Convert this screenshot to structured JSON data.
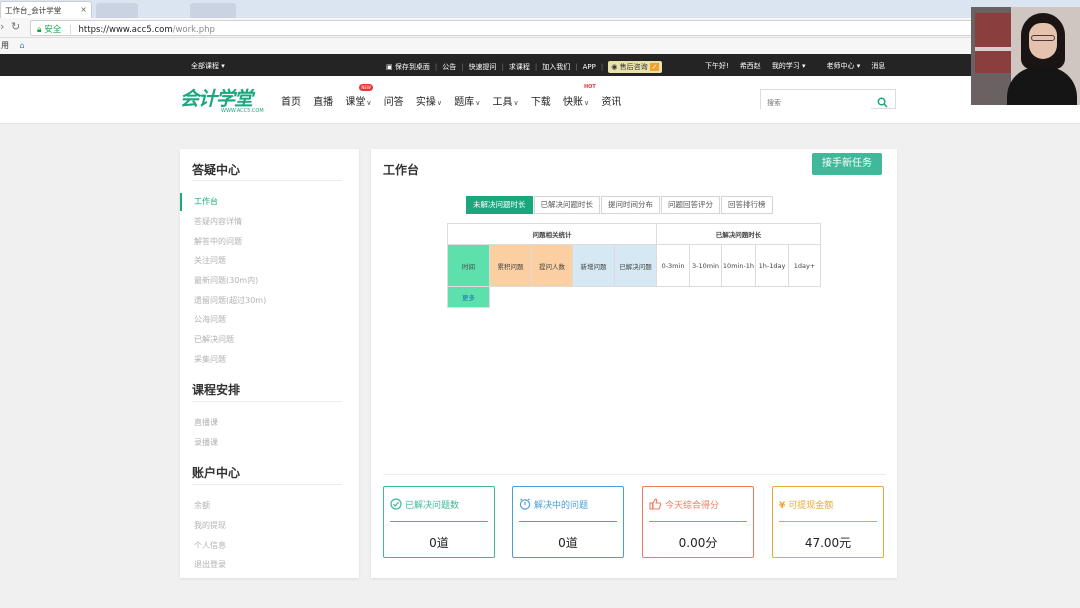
{
  "browser": {
    "tab_title": "工作台_会计学堂",
    "tab_close": "×",
    "security_label": "安全",
    "url_host": "https://www.acc5.com",
    "url_path": "/work.php",
    "bookmarks_label": "用"
  },
  "topbar": {
    "all_courses": "全部课程 ▾",
    "links": [
      "保存到桌面",
      "公告",
      "快速提问",
      "求课程",
      "加入我们",
      "APP"
    ],
    "support": "售后咨询",
    "greeting": "下午好!",
    "username": "希西赵",
    "my_study": "我的学习 ▾",
    "teacher_center": "老师中心 ▾",
    "messages": "消息"
  },
  "header": {
    "logo_cn": "会计学堂",
    "logo_en": "WWW.ACC5.COM",
    "nav": [
      {
        "label": "首页",
        "caret": false
      },
      {
        "label": "直播",
        "caret": false
      },
      {
        "label": "课堂",
        "caret": true,
        "badge": "NEW"
      },
      {
        "label": "问答",
        "caret": false
      },
      {
        "label": "实操",
        "caret": true
      },
      {
        "label": "题库",
        "caret": true
      },
      {
        "label": "工具",
        "caret": true
      },
      {
        "label": "下载",
        "caret": false
      },
      {
        "label": "快账",
        "caret": true,
        "badge": "HOT"
      },
      {
        "label": "资讯",
        "caret": false
      }
    ],
    "search_placeholder": "搜索"
  },
  "sidebar": {
    "qa_title": "答疑中心",
    "qa_items": [
      "工作台",
      "答疑内容详情",
      "解答中的问题",
      "关注问题",
      "最新问题(30m内)",
      "遗留问题(超过30m)",
      "公海问题",
      "已解决问题",
      "采集问题"
    ],
    "course_title": "课程安排",
    "course_items": [
      "直播课",
      "录播课"
    ],
    "account_title": "账户中心",
    "account_items": [
      "余额",
      "我的提现",
      "个人信息",
      "退出登录"
    ]
  },
  "main": {
    "title": "工作台",
    "task_button": "接手新任务",
    "tabs": [
      "未解决问题时长",
      "已解决问题时长",
      "提问时间分布",
      "问题回答评分",
      "回答排行榜"
    ],
    "table": {
      "group1": "问题相关统计",
      "group2": "已解决问题时长",
      "cols": [
        "时间",
        "累积问题",
        "提问人数",
        "新增问题",
        "已解决问题",
        "0-3min",
        "3-10min",
        "10min-1h",
        "1h-1day",
        "1day+"
      ],
      "more": "更多"
    },
    "cards": [
      {
        "title": "已解决问题数",
        "value": "0道",
        "color": "#40b89a",
        "icon": "check-circle-icon"
      },
      {
        "title": "解决中的问题",
        "value": "0道",
        "color": "#4a9fd8",
        "icon": "alarm-icon"
      },
      {
        "title": "今天综合得分",
        "value": "0.00分",
        "color": "#ee7a5e",
        "icon": "thumbs-up-icon"
      },
      {
        "title": "可提现金额",
        "value": "47.00元",
        "color": "#e8a93b",
        "icon": "yen-icon"
      }
    ]
  }
}
